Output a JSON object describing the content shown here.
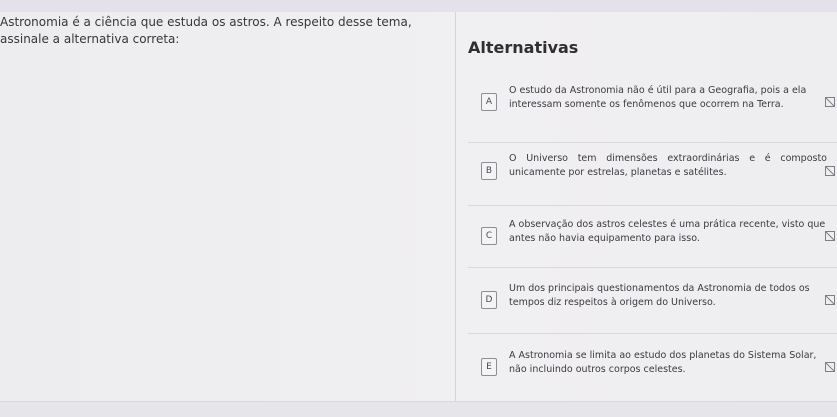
{
  "question": {
    "text": "Astronomia é a ciência que estuda os astros. A respeito desse tema, assinale a alternativa correta:"
  },
  "answers": {
    "title": "Alternativas",
    "options": [
      {
        "letter": "A",
        "text": "O estudo da Astronomia não é útil para a Geografia, pois a ela interessam somente os fenômenos que ocorrem na Terra."
      },
      {
        "letter": "B",
        "text": "O Universo tem dimensões extraordinárias e é composto unicamente por estrelas, planetas e satélites."
      },
      {
        "letter": "C",
        "text": "A observação dos astros celestes é uma prática recente, visto que antes não havia equipamento para isso."
      },
      {
        "letter": "D",
        "text": "Um dos principais questionamentos da Astronomia de todos os tempos diz respeitos à origem do Universo."
      },
      {
        "letter": "E",
        "text": "A Astronomia se limita ao estudo dos planetas do Sistema Solar, não incluindo outros corpos celestes."
      }
    ],
    "option_icon": "strike-option-icon"
  }
}
